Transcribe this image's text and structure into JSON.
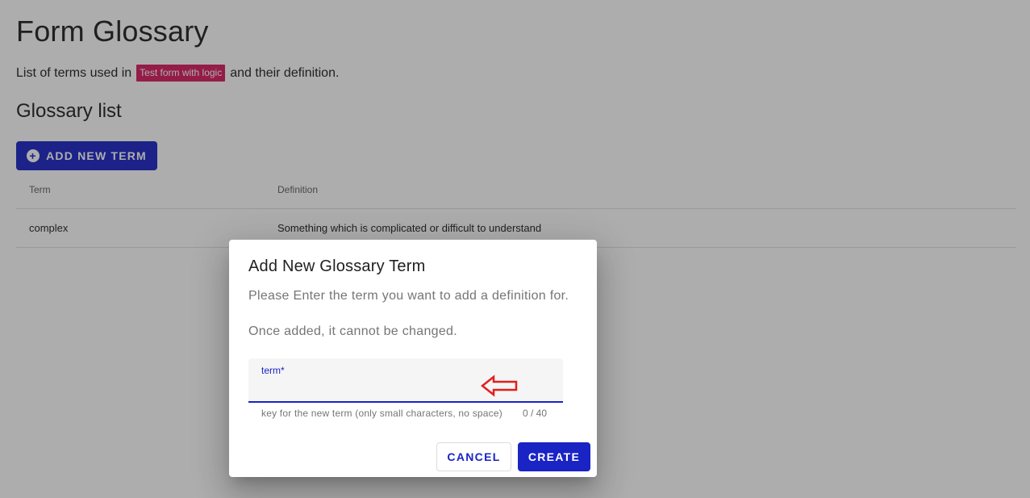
{
  "page": {
    "title": "Form Glossary",
    "intro_prefix": "List of terms used in",
    "form_name": "Test form with logic",
    "intro_suffix": "and their definition.",
    "section_title": "Glossary list",
    "add_button_label": "ADD NEW TERM",
    "add_button_icon": "plus-circle-icon"
  },
  "table": {
    "columns": [
      "Term",
      "Definition"
    ],
    "rows": [
      {
        "term": "complex",
        "definition": "Something which is complicated or difficult to understand"
      }
    ]
  },
  "dialog": {
    "title": "Add New Glossary Term",
    "text_1": "Please Enter the term you want to add a definition for.",
    "text_2": "Once added, it cannot be changed.",
    "field_label": "term*",
    "field_value": "",
    "hint": "key for the new term (only small characters, no space)",
    "counter": "0 / 40",
    "cancel_label": "CANCEL",
    "create_label": "CREATE",
    "annotation_icon": "red-arrow-left-icon"
  },
  "colors": {
    "primary": "#1a23c4",
    "chip": "#d81b60",
    "annotation": "#e0201e"
  }
}
